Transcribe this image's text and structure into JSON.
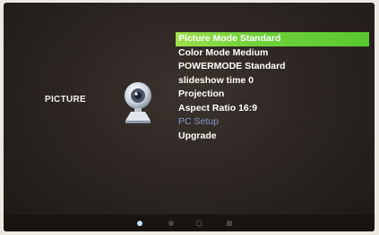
{
  "section": {
    "label": "PICTURE",
    "icon": "webcam-icon"
  },
  "menu": {
    "items": [
      {
        "label": "Picture Mode Standard",
        "selected": true
      },
      {
        "label": "Color Mode Medium"
      },
      {
        "label": "POWERMODE Standard"
      },
      {
        "label": "slideshow time 0"
      },
      {
        "label": "Projection"
      },
      {
        "label": "Aspect Ratio 16:9"
      },
      {
        "label": "PC Setup",
        "dimmed": true
      },
      {
        "label": "Upgrade"
      }
    ]
  },
  "bottom_nav": {
    "icons": [
      "picture-tab-icon",
      "sound-tab-icon",
      "setup-tab-icon",
      "info-tab-icon"
    ],
    "active": "picture-tab-icon"
  },
  "colors": {
    "highlight": "#6fd23a",
    "menu_text": "#ffffff",
    "dimmed_text": "#8a9bd0",
    "background": "#2a2420"
  }
}
